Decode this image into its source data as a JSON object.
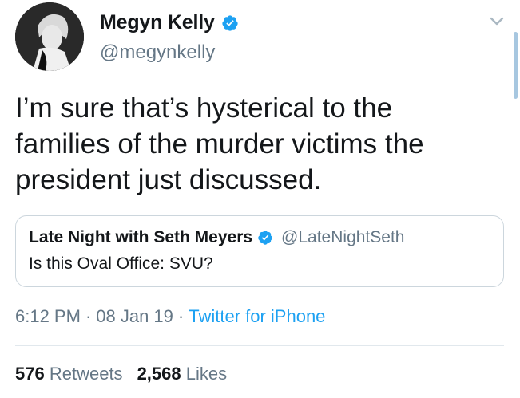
{
  "author": {
    "display_name": "Megyn Kelly",
    "handle": "@megynkelly",
    "verified": true
  },
  "icons": {
    "verified": "verified-badge-icon",
    "menu": "chevron-down-icon"
  },
  "tweet": {
    "text": "I’m sure that’s hysterical to the\nfamilies of the murder victims the\npresident just discussed."
  },
  "quoted_tweet": {
    "display_name": "Late Night with Seth Meyers",
    "handle": "@LateNightSeth",
    "verified": true,
    "text": "Is this Oval Office: SVU?"
  },
  "meta": {
    "time": "6:12 PM",
    "separator": "·",
    "date": "08 Jan 19",
    "source": "Twitter for iPhone"
  },
  "stats": {
    "retweets_count": "576",
    "retweets_label": "Retweets",
    "likes_count": "2,568",
    "likes_label": "Likes"
  },
  "colors": {
    "accent": "#1da1f2",
    "secondary_text": "#657786",
    "primary_text": "#14171a",
    "border": "#ccd6dd"
  }
}
